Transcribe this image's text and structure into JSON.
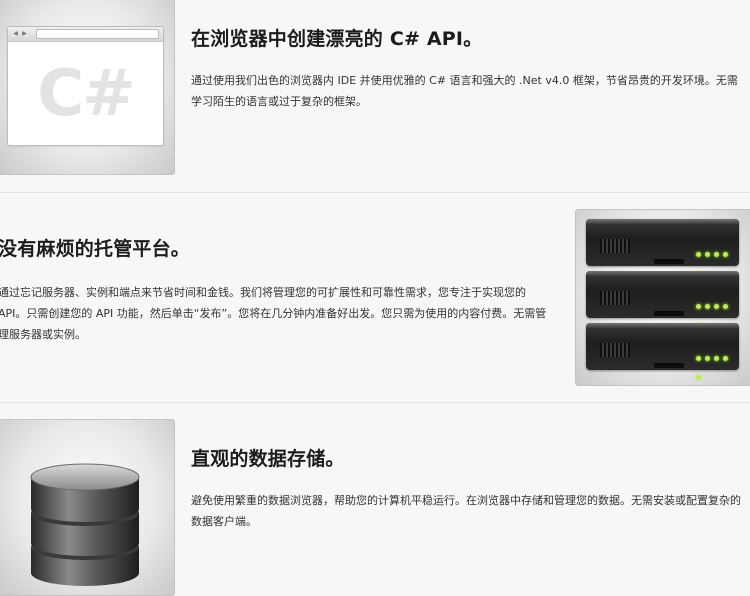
{
  "sections": [
    {
      "title": "在浏览器中创建漂亮的 C# API。",
      "body": "通过使用我们出色的浏览器内 IDE 并使用优雅的 C# 语言和强大的 .Net v4.0 框架，节省昂贵的开发环境。无需学习陌生的语言或过于复杂的框架。",
      "icon": "browser-csharp-icon",
      "icon_text": "C#"
    },
    {
      "title": "没有麻烦的托管平台。",
      "body": "通过忘记服务器、实例和端点来节省时间和金钱。我们将管理您的可扩展性和可靠性需求，您专注于实现您的 API。只需创建您的 API 功能，然后单击“发布”。您将在几分钟内准备好出发。您只需为使用的内容付费。无需管理服务器或实例。",
      "icon": "server-rack-icon"
    },
    {
      "title": "直观的数据存储。",
      "body": "避免使用繁重的数据浏览器，帮助您的计算机平稳运行。在浏览器中存储和管理您的数据。无需安装或配置复杂的数据客户端。",
      "icon": "database-icon"
    }
  ],
  "colors": {
    "background": "#f7f7f7",
    "divider": "#e2e2e2",
    "led": "#b8f049"
  }
}
